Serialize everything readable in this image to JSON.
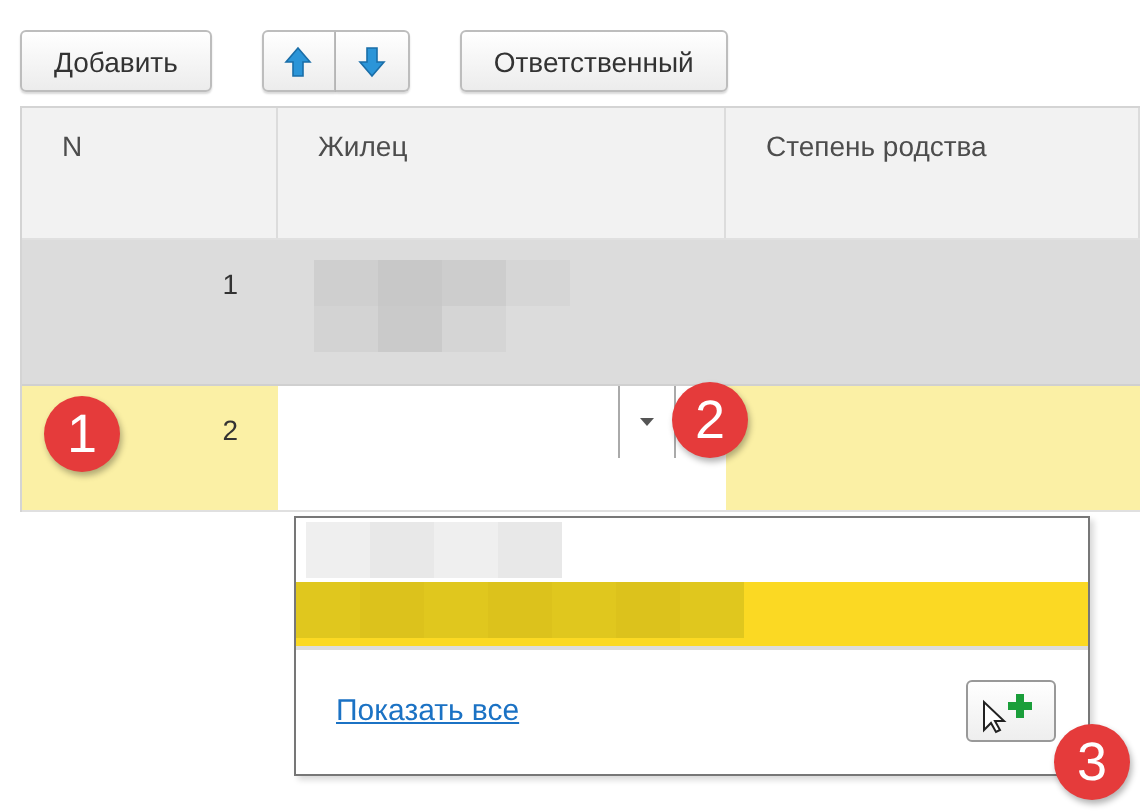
{
  "toolbar": [
    {
      "kind": "text",
      "label": "Добавить"
    },
    {
      "kind": "arrows"
    },
    {
      "kind": "text",
      "label": "Ответственный"
    }
  ],
  "table": {
    "columns": [
      "N",
      "Жилец",
      "Степень родства"
    ],
    "rows": [
      {
        "n": "1",
        "selected": false,
        "editing": false
      },
      {
        "n": "2",
        "selected": true,
        "editing": true
      }
    ]
  },
  "popup": {
    "items": [
      {
        "selected": false
      },
      {
        "selected": true
      }
    ],
    "link": "Показать все"
  },
  "markers": [
    "1",
    "2",
    "3"
  ]
}
